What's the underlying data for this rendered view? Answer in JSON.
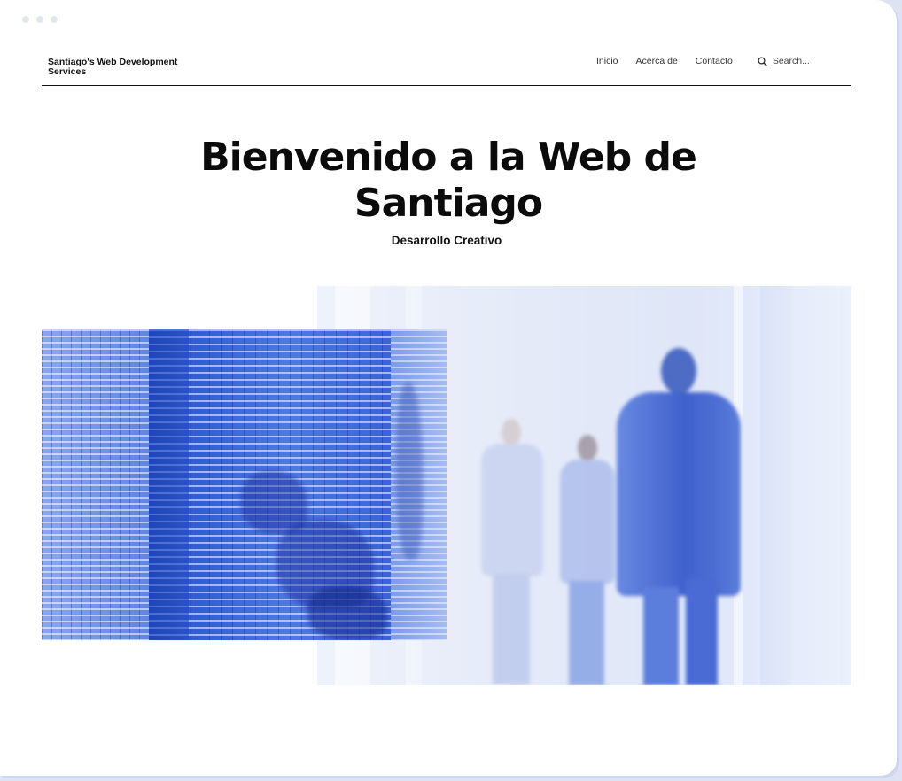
{
  "site": {
    "brand": "Santiago's Web Development Services"
  },
  "nav": {
    "items": [
      {
        "label": "Inicio"
      },
      {
        "label": "Acerca de"
      },
      {
        "label": "Contacto"
      }
    ],
    "search": {
      "placeholder": "Search...",
      "icon": "search-icon"
    }
  },
  "hero": {
    "title_line1": "Bienvenido a la Web de",
    "title_line2": "Santiago",
    "subtitle": "Desarrollo Creativo"
  },
  "images": {
    "building": {
      "alt": "blue glass skyscraper facade"
    },
    "people": {
      "alt": "blurred business people walking in office corridor"
    }
  },
  "colors": {
    "accent_blue": "#3f68d4",
    "text": "#111111",
    "background": "#ffffff"
  }
}
